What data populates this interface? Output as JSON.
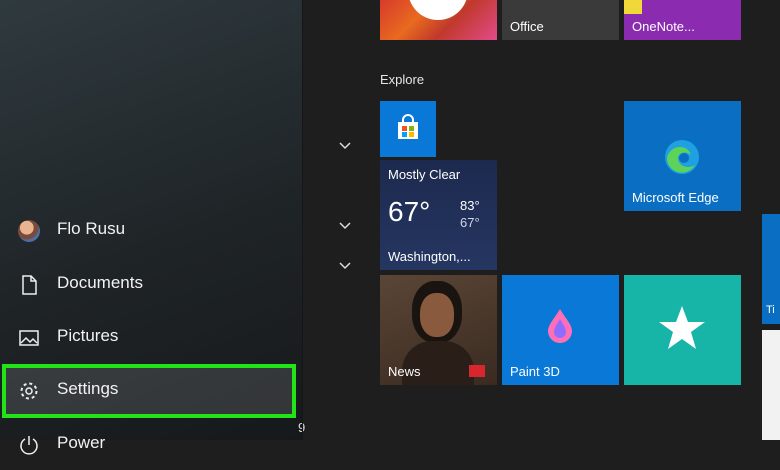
{
  "sidebar": {
    "user": "Flo Rusu",
    "documents": "Documents",
    "pictures": "Pictures",
    "settings": "Settings",
    "power": "Power",
    "badge": "9"
  },
  "tiles": {
    "section": "Explore",
    "office": "Office",
    "onenote": "OneNote...",
    "weather": {
      "condition": "Mostly Clear",
      "temp": "67°",
      "high": "83°",
      "low": "67°",
      "city": "Washington,..."
    },
    "edge": "Microsoft Edge",
    "news": "News",
    "paint3d": "Paint 3D",
    "partial": "Ti"
  },
  "colors": {
    "highlight": "#22e317",
    "tile_blue": "#0a78d7",
    "weather_blue": "#1d2a4f",
    "onenote_purple": "#8b2bb0"
  }
}
